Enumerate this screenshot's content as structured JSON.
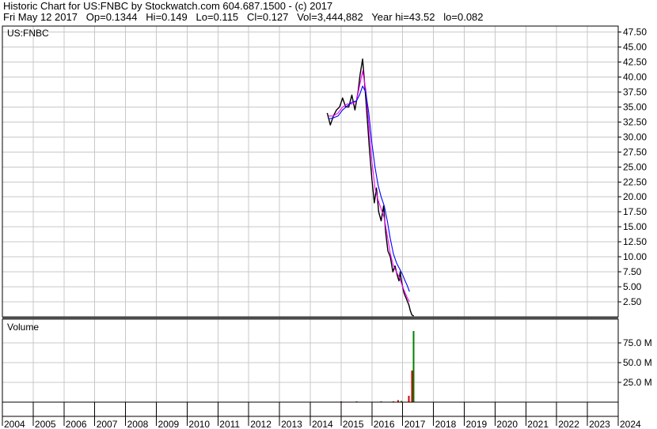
{
  "header": {
    "line1": "Historic Chart for US:FNBC by Stockwatch.com 604.687.1500 - (c) 2017",
    "line2": "Fri May 12 2017   Op=0.1344   Hi=0.149   Lo=0.115   Cl=0.127   Vol=3,444,882   Year hi=43.52   lo=0.082"
  },
  "chart_data": [
    {
      "type": "line",
      "pane": "price",
      "symbol_label": "US:FNBC",
      "y_ticks": [
        "47.50",
        "45.00",
        "42.50",
        "40.00",
        "37.50",
        "35.00",
        "32.50",
        "30.00",
        "27.50",
        "25.00",
        "22.50",
        "20.00",
        "17.50",
        "15.00",
        "12.50",
        "10.00",
        "7.50",
        "5.00",
        "2.50"
      ],
      "ylim": [
        0,
        48.5
      ],
      "xlim": [
        2004,
        2024
      ],
      "grid": true,
      "series": [
        {
          "color": "#000000",
          "x": [
            2014.55,
            2014.65,
            2014.75,
            2014.85,
            2014.95,
            2015.05,
            2015.15,
            2015.25,
            2015.35,
            2015.45,
            2015.55,
            2015.62,
            2015.7,
            2015.78,
            2015.85,
            2015.92,
            2016.0,
            2016.08,
            2016.15,
            2016.22,
            2016.3,
            2016.38,
            2016.45,
            2016.52,
            2016.6,
            2016.68,
            2016.75,
            2016.82,
            2016.88,
            2016.92,
            2016.96,
            2017.0,
            2017.04,
            2017.08,
            2017.12,
            2017.16,
            2017.2,
            2017.25,
            2017.3,
            2017.36
          ],
          "y": [
            34.0,
            32.0,
            33.5,
            34.5,
            35.0,
            36.5,
            35.0,
            35.0,
            37.0,
            34.5,
            37.5,
            40.5,
            43.0,
            38.0,
            33.0,
            28.0,
            23.0,
            19.0,
            21.5,
            17.5,
            16.0,
            18.5,
            14.0,
            11.0,
            10.0,
            7.5,
            8.5,
            7.0,
            6.0,
            7.5,
            6.0,
            5.0,
            4.0,
            3.5,
            3.0,
            2.5,
            2.0,
            1.0,
            0.3,
            0.127
          ]
        },
        {
          "color": "#ff00ff",
          "x": [
            2014.6,
            2014.75,
            2014.9,
            2015.05,
            2015.2,
            2015.35,
            2015.5,
            2015.6,
            2015.7,
            2015.8,
            2015.9,
            2016.0,
            2016.1,
            2016.2,
            2016.3,
            2016.4,
            2016.5,
            2016.6,
            2016.7,
            2016.8,
            2016.9,
            2017.0,
            2017.08,
            2017.15,
            2017.22
          ],
          "y": [
            33.5,
            33.5,
            34.0,
            35.0,
            35.5,
            35.5,
            36.0,
            38.5,
            41.0,
            38.0,
            32.0,
            26.0,
            21.5,
            19.5,
            18.0,
            16.5,
            13.5,
            10.5,
            8.5,
            7.5,
            6.5,
            5.0,
            4.0,
            3.2,
            2.5
          ]
        },
        {
          "color": "#0000ff",
          "x": [
            2014.6,
            2014.75,
            2014.9,
            2015.05,
            2015.2,
            2015.35,
            2015.5,
            2015.6,
            2015.7,
            2015.8,
            2015.9,
            2016.0,
            2016.1,
            2016.2,
            2016.3,
            2016.4,
            2016.5,
            2016.6,
            2016.7,
            2016.8,
            2016.9,
            2017.0,
            2017.08,
            2017.15,
            2017.22
          ],
          "y": [
            33.0,
            33.2,
            33.5,
            34.5,
            35.2,
            35.8,
            36.0,
            37.0,
            38.5,
            37.5,
            34.0,
            29.0,
            25.0,
            22.0,
            20.0,
            18.5,
            16.0,
            13.0,
            10.5,
            9.0,
            8.0,
            7.0,
            6.0,
            5.2,
            4.2
          ]
        }
      ]
    },
    {
      "type": "bar",
      "pane": "volume",
      "label": "Volume",
      "y_ticks": [
        "75.0 M",
        "50.0 M",
        "25.0 M"
      ],
      "y_tick_values": [
        75,
        50,
        25
      ],
      "ylim": [
        0,
        105
      ],
      "xlim": [
        2004,
        2024
      ],
      "grid": true,
      "up_color": "#008000",
      "down_color": "#cc0000",
      "bars": [
        {
          "x": 2014.6,
          "value": 0.6,
          "dir": "down"
        },
        {
          "x": 2015.0,
          "value": 0.8,
          "dir": "down"
        },
        {
          "x": 2015.5,
          "value": 0.8,
          "dir": "up"
        },
        {
          "x": 2016.3,
          "value": 0.8,
          "dir": "up"
        },
        {
          "x": 2016.7,
          "value": 1.2,
          "dir": "down"
        },
        {
          "x": 2016.85,
          "value": 2.5,
          "dir": "down"
        },
        {
          "x": 2016.95,
          "value": 1.6,
          "dir": "up"
        },
        {
          "x": 2017.2,
          "value": 8.0,
          "dir": "down"
        },
        {
          "x": 2017.3,
          "value": 40.0,
          "dir": "down"
        },
        {
          "x": 2017.36,
          "value": 90.0,
          "dir": "up"
        }
      ]
    }
  ],
  "x_axis": {
    "years": [
      "2004",
      "2005",
      "2006",
      "2007",
      "2008",
      "2009",
      "2010",
      "2011",
      "2012",
      "2013",
      "2014",
      "2015",
      "2016",
      "2017",
      "2018",
      "2019",
      "2020",
      "2021",
      "2022",
      "2023",
      "2024"
    ]
  }
}
